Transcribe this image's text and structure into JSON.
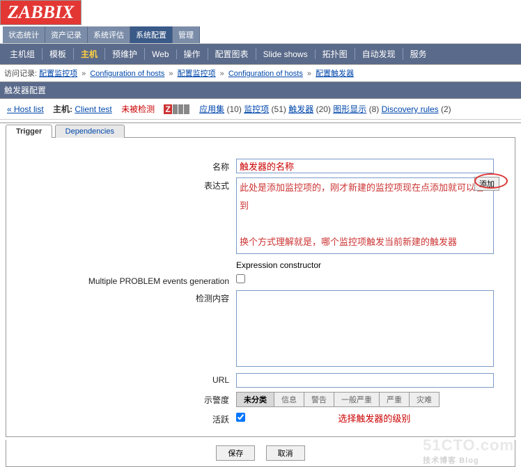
{
  "logo": "ZABBIX",
  "top_tabs": [
    "状态统计",
    "资产记录",
    "系统评估",
    "系统配置",
    "管理"
  ],
  "top_active": 3,
  "sub_tabs": [
    "主机组",
    "模板",
    "主机",
    "预维护",
    "Web",
    "操作",
    "配置图表",
    "Slide shows",
    "拓扑图",
    "自动发现",
    "服务"
  ],
  "sub_active": 2,
  "breadcrumb": {
    "label": "访问记录:",
    "items": [
      "配置监控项",
      "Configuration of hosts",
      "配置监控项",
      "Configuration of hosts",
      "配置触发器"
    ]
  },
  "section_title": "触发器配置",
  "hostbar": {
    "hostlist": "« Host list",
    "host_label": "主机:",
    "host_name": "Client test",
    "not_detected": "未被检测",
    "items": [
      {
        "label": "应用集",
        "count": "(10)"
      },
      {
        "label": "监控项",
        "count": "(51)"
      },
      {
        "label": "触发器",
        "count": "(20)"
      },
      {
        "label": "图形显示",
        "count": "(8)"
      },
      {
        "label": "Discovery rules",
        "count": "(2)"
      }
    ]
  },
  "inner_tabs": [
    "Trigger",
    "Dependencies"
  ],
  "form": {
    "name_label": "名称",
    "name_value": "触发器的名称",
    "expression_label": "表达式",
    "expression_text": "此处是添加监控项的，刚才新建的监控项现在点添加就可以看到\n\n换个方式理解就是，哪个监控项触发当前新建的触发器",
    "add_button": "添加",
    "exp_constructor": "Expression constructor",
    "multi_problem": "Multiple PROBLEM events generation",
    "detect_content": "检测内容",
    "url_label": "URL",
    "severity_label": "示警度",
    "severity_options": [
      "未分类",
      "信息",
      "警告",
      "一般严重",
      "严重",
      "灾难"
    ],
    "severity_note": "选择触发器的级别",
    "active_label": "活跃"
  },
  "footer": {
    "save": "保存",
    "cancel": "取消"
  },
  "watermark": {
    "main": "51CTO.com",
    "sub": "技术博客 Blog"
  }
}
